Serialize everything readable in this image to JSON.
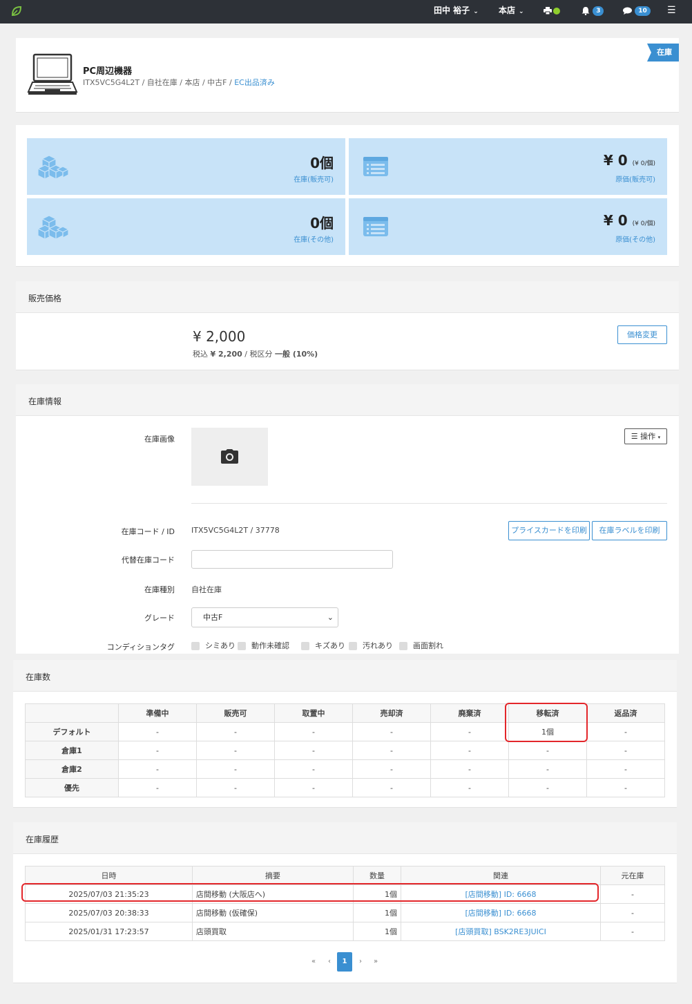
{
  "topbar": {
    "user": "田中 裕子",
    "store": "本店",
    "notifications": "3",
    "messages": "10",
    "printer_status_color": "#8fce2d"
  },
  "product": {
    "status_ribbon": "在庫",
    "title": "PC周辺機器",
    "subtitle": "ITX5VC5G4L2T / 自社在庫 / 本店 / 中古F / ",
    "ec_link": "EC出品済み",
    "icon": "laptop-icon"
  },
  "stats": [
    {
      "value": "0個",
      "label": "在庫(販売可)",
      "icon": "cubes-icon"
    },
    {
      "value": "¥ 0",
      "sub": "(¥ 0/個)",
      "label": "原価(販売可)",
      "icon": "list-card-icon"
    },
    {
      "value": "0個",
      "label": "在庫(その他)",
      "icon": "cubes-icon"
    },
    {
      "value": "¥ 0",
      "sub": "(¥ 0/個)",
      "label": "原価(その他)",
      "icon": "list-card-icon"
    }
  ],
  "price": {
    "heading": "販売価格",
    "amount": "¥ 2,000",
    "tax_prefix": "税込",
    "tax_amount": "¥ 2,200",
    "tax_mid": " / 税区分",
    "tax_class": "一般 (10%)",
    "change_button": "価格変更"
  },
  "info": {
    "heading": "在庫情報",
    "image_label": "在庫画像",
    "ops_button": "操作",
    "code_label": "在庫コード / ID",
    "code_value": "ITX5VC5G4L2T / 37778",
    "print_price_card": "プライスカードを印刷",
    "print_label": "在庫ラベルを印刷",
    "alt_code_label": "代替在庫コード",
    "alt_code_value": "",
    "type_label": "在庫種別",
    "type_value": "自社在庫",
    "grade_label": "グレード",
    "grade_value": "中古F",
    "condition_label": "コンディションタグ",
    "condition_tags": [
      "シミあり",
      "動作未確認",
      "キズあり",
      "汚れあり",
      "画面割れ"
    ]
  },
  "counts": {
    "heading": "在庫数",
    "columns": [
      "",
      "準備中",
      "販売可",
      "取置中",
      "売却済",
      "廃棄済",
      "移転済",
      "返品済"
    ],
    "rows": [
      {
        "name": "デフォルト",
        "cells": [
          "-",
          "-",
          "-",
          "-",
          "-",
          "1個",
          "-"
        ]
      },
      {
        "name": "倉庫1",
        "cells": [
          "-",
          "-",
          "-",
          "-",
          "-",
          "-",
          "-"
        ]
      },
      {
        "name": "倉庫2",
        "cells": [
          "-",
          "-",
          "-",
          "-",
          "-",
          "-",
          "-"
        ]
      },
      {
        "name": "優先",
        "cells": [
          "-",
          "-",
          "-",
          "-",
          "-",
          "-",
          "-"
        ]
      }
    ]
  },
  "history": {
    "heading": "在庫履歴",
    "columns": [
      "日時",
      "摘要",
      "数量",
      "関連",
      "元在庫"
    ],
    "rows": [
      {
        "date": "2025/07/03 21:35:23",
        "summary": "店間移動 (大阪店へ)",
        "qty": "1個",
        "related": "[店間移動] ID: 6668",
        "origin": "-"
      },
      {
        "date": "2025/07/03 20:38:33",
        "summary": "店間移動 (仮確保)",
        "qty": "1個",
        "related": "[店間移動] ID: 6668",
        "origin": "-"
      },
      {
        "date": "2025/01/31 17:23:57",
        "summary": "店頭買取",
        "qty": "1個",
        "related": "[店頭買取] BSK2RE3JUICI",
        "origin": "-"
      }
    ]
  },
  "pagination": {
    "first": "«",
    "prev": "‹",
    "current": "1",
    "next": "›",
    "last": "»"
  },
  "colors": {
    "accent": "#3a8fd1",
    "tile": "#c8e3f8",
    "highlight": "#e3262a",
    "topbar": "#2d3137"
  }
}
